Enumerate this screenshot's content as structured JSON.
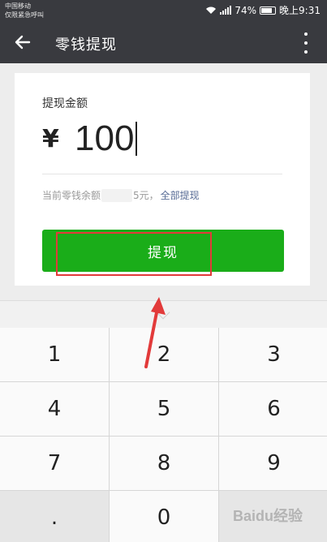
{
  "status": {
    "carrier_line1": "中国移动",
    "carrier_line2": "仅限紧急呼叫",
    "battery": "74%",
    "time": "晚上9:31"
  },
  "appbar": {
    "title": "零钱提现"
  },
  "form": {
    "amount_label": "提现金额",
    "currency": "¥",
    "amount": "100",
    "balance_prefix": "当前零钱余额",
    "balance_suffix": "5元，",
    "withdraw_all": "全部提现",
    "button_label": "提现"
  },
  "keypad": {
    "keys": [
      "1",
      "2",
      "3",
      "4",
      "5",
      "6",
      "7",
      "8",
      "9",
      ".",
      "0",
      ""
    ]
  },
  "watermark": "Baidu经验",
  "colors": {
    "bar": "#393a3f",
    "primary": "#1aad19",
    "link": "#576b95",
    "highlight": "#e23a3a"
  }
}
